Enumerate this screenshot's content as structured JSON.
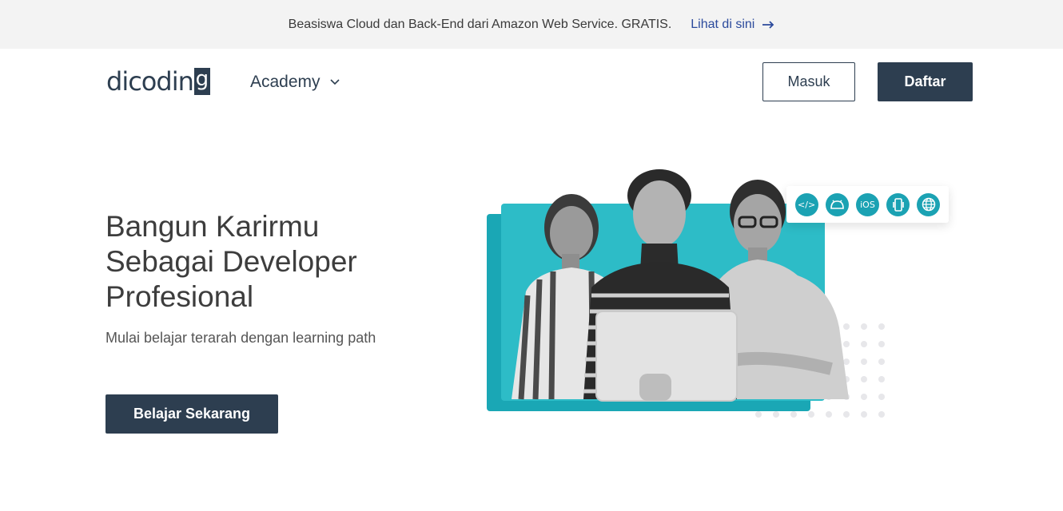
{
  "announcement": {
    "text": "Beasiswa Cloud dan Back-End dari Amazon Web Service. GRATIS.",
    "link_label": "Lihat di sini"
  },
  "navbar": {
    "logo_text": "dicodin",
    "logo_box_letter": "g",
    "academy_label": "Academy",
    "login_label": "Masuk",
    "register_label": "Daftar"
  },
  "hero": {
    "title_lines": [
      "Bangun Karirmu",
      "Sebagai Developer",
      "Profesional"
    ],
    "subtitle": "Mulai belajar terarah dengan learning path",
    "cta_label": "Belajar Sekarang"
  },
  "tech_icons": [
    {
      "name": "code-icon",
      "glyph": "</>"
    },
    {
      "name": "android-icon",
      "glyph": ""
    },
    {
      "name": "ios-icon",
      "glyph": "iOS"
    },
    {
      "name": "multiplatform-icon",
      "glyph": ""
    },
    {
      "name": "web-icon",
      "glyph": ""
    }
  ],
  "colors": {
    "primary": "#2d3e50",
    "link": "#2b4a9c",
    "teal": "#2dbcc7",
    "teal_dark": "#1aa7b5",
    "topbar_bg": "#f3f3f3"
  }
}
